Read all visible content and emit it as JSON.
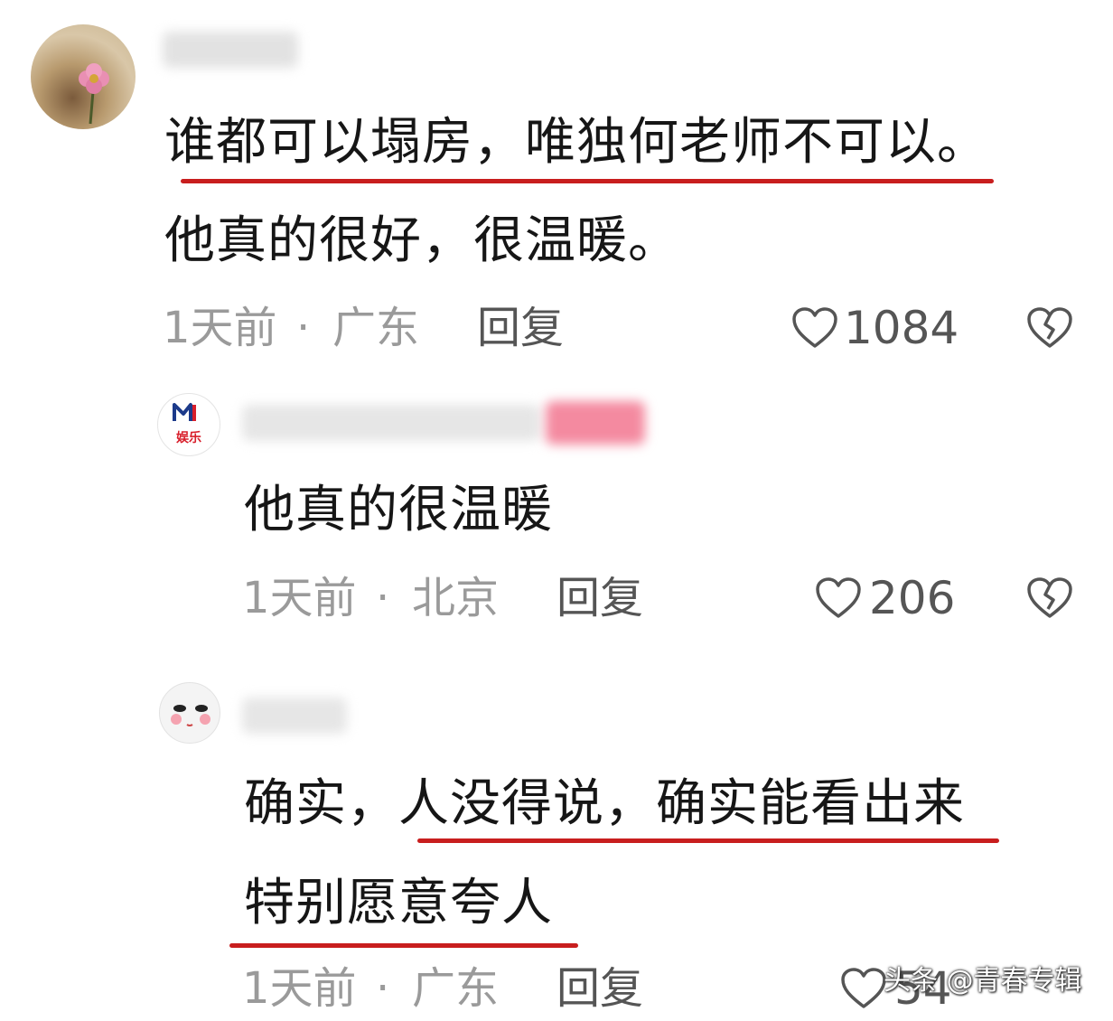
{
  "comments": [
    {
      "text_lines": [
        "谁都可以塌房，唯独何老师不可以。",
        "他真的很好，很温暖。"
      ],
      "time": "1天前",
      "sep": "·",
      "location": "广东",
      "reply_label": "回复",
      "likes": "1084"
    },
    {
      "avatar_text": "娱乐",
      "text_lines": [
        "他真的很温暖"
      ],
      "time": "1天前",
      "sep": "·",
      "location": "北京",
      "reply_label": "回复",
      "likes": "206"
    },
    {
      "text_lines": [
        "确实，人没得说，确实能看出来",
        "特别愿意夸人"
      ],
      "time": "1天前",
      "sep": "·",
      "location": "广东",
      "reply_label": "回复",
      "likes": "54"
    }
  ],
  "watermark": "头条 @青春专辑",
  "colors": {
    "underline": "#c81e1e",
    "meta": "#9a9a9a",
    "text": "#161616"
  },
  "icons": [
    "heart-icon",
    "broken-heart-icon",
    "location-icon"
  ]
}
